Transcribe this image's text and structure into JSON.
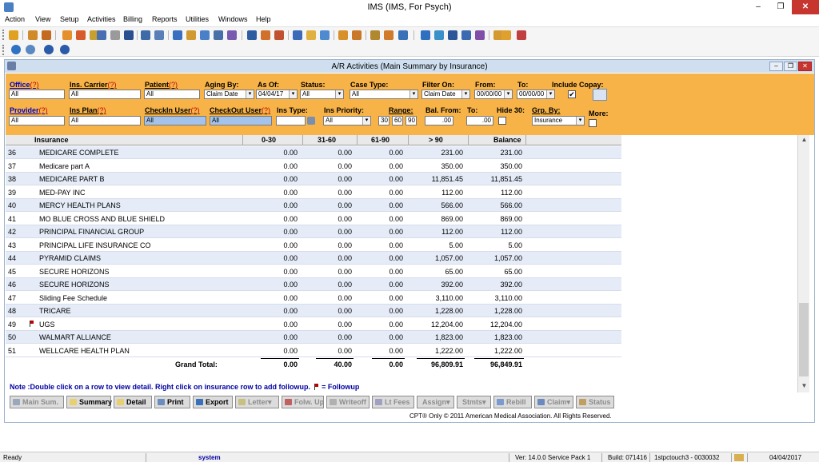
{
  "window": {
    "title": "IMS (IMS, For Psych)",
    "min": "–",
    "max": "❐",
    "close": "✕"
  },
  "menu": [
    "Action",
    "View",
    "Setup",
    "Activities",
    "Billing",
    "Reports",
    "Utilities",
    "Windows",
    "Help"
  ],
  "child": {
    "title": "A/R Activities  (Main Summary by Insurance)"
  },
  "filters": {
    "office": {
      "label": "Office",
      "q": "(?)",
      "value": "All"
    },
    "ins_carrier": {
      "label": "Ins. Carrier",
      "q": "(?)",
      "value": "All"
    },
    "patient": {
      "label": "Patient",
      "q": "(?)",
      "value": "All"
    },
    "aging_by": {
      "label": "Aging By:",
      "value": "Claim Date"
    },
    "as_of": {
      "label": "As Of:",
      "value": "04/04/17"
    },
    "status": {
      "label": "Status:",
      "value": "All"
    },
    "case_type": {
      "label": "Case Type:",
      "value": "All"
    },
    "filter_on": {
      "label": "Filter On:",
      "value": "Claim Date"
    },
    "from": {
      "label": "From:",
      "value": "00/00/00"
    },
    "to": {
      "label": "To:",
      "value": "00/00/00"
    },
    "include_copay": {
      "label": "Include Copay:",
      "check": "✔"
    },
    "provider": {
      "label": "Provider",
      "q": "(?)",
      "value": "All"
    },
    "ins_plan": {
      "label": "Ins Plan",
      "q": "(?)",
      "value": "All"
    },
    "checkin_user": {
      "label": "CheckIn User",
      "q": "(?)",
      "value": "All"
    },
    "checkout_user": {
      "label": "CheckOut User",
      "q": "(?)",
      "value": "All"
    },
    "ins_type": {
      "label": "Ins Type:",
      "value": ""
    },
    "ins_priority": {
      "label": "Ins Priority:",
      "value": "All"
    },
    "range": {
      "label": "Range:",
      "r1": "30",
      "r2": "60",
      "r3": "90"
    },
    "bal_from": {
      "label": "Bal. From:",
      "value": ".00"
    },
    "bal_to": {
      "label": "To:",
      "value": ".00"
    },
    "hide30": {
      "label": "Hide 30:"
    },
    "grp_by": {
      "label": "Grp. By:",
      "value": "Insurance"
    },
    "more": {
      "label": "More:"
    },
    "dropdown_glyph": "▾"
  },
  "grid": {
    "headers": [
      "Insurance",
      "0-30",
      "31-60",
      "61-90",
      "> 90",
      "Balance"
    ],
    "rows": [
      {
        "num": "36",
        "ins": "MEDICARE COMPLETE",
        "c1": "0.00",
        "c2": "0.00",
        "c3": "0.00",
        "c4": "231.00",
        "bal": "231.00",
        "flag": false
      },
      {
        "num": "37",
        "ins": "Medicare part A",
        "c1": "0.00",
        "c2": "0.00",
        "c3": "0.00",
        "c4": "350.00",
        "bal": "350.00",
        "flag": false
      },
      {
        "num": "38",
        "ins": "MEDICARE PART B",
        "c1": "0.00",
        "c2": "0.00",
        "c3": "0.00",
        "c4": "11,851.45",
        "bal": "11,851.45",
        "flag": false
      },
      {
        "num": "39",
        "ins": "MED-PAY INC",
        "c1": "0.00",
        "c2": "0.00",
        "c3": "0.00",
        "c4": "112.00",
        "bal": "112.00",
        "flag": false
      },
      {
        "num": "40",
        "ins": "MERCY HEALTH PLANS",
        "c1": "0.00",
        "c2": "0.00",
        "c3": "0.00",
        "c4": "566.00",
        "bal": "566.00",
        "flag": false
      },
      {
        "num": "41",
        "ins": "MO BLUE CROSS AND BLUE SHIELD",
        "c1": "0.00",
        "c2": "0.00",
        "c3": "0.00",
        "c4": "869.00",
        "bal": "869.00",
        "flag": false
      },
      {
        "num": "42",
        "ins": "PRINCIPAL FINANCIAL GROUP",
        "c1": "0.00",
        "c2": "0.00",
        "c3": "0.00",
        "c4": "112.00",
        "bal": "112.00",
        "flag": false
      },
      {
        "num": "43",
        "ins": "PRINCIPAL LIFE INSURANCE CO",
        "c1": "0.00",
        "c2": "0.00",
        "c3": "0.00",
        "c4": "5.00",
        "bal": "5.00",
        "flag": false
      },
      {
        "num": "44",
        "ins": "PYRAMID CLAIMS",
        "c1": "0.00",
        "c2": "0.00",
        "c3": "0.00",
        "c4": "1,057.00",
        "bal": "1,057.00",
        "flag": false
      },
      {
        "num": "45",
        "ins": "SECURE HORIZONS",
        "c1": "0.00",
        "c2": "0.00",
        "c3": "0.00",
        "c4": "65.00",
        "bal": "65.00",
        "flag": false
      },
      {
        "num": "46",
        "ins": "SECURE HORIZONS",
        "c1": "0.00",
        "c2": "0.00",
        "c3": "0.00",
        "c4": "392.00",
        "bal": "392.00",
        "flag": false
      },
      {
        "num": "47",
        "ins": "Sliding Fee Schedule",
        "c1": "0.00",
        "c2": "0.00",
        "c3": "0.00",
        "c4": "3,110.00",
        "bal": "3,110.00",
        "flag": false
      },
      {
        "num": "48",
        "ins": "TRICARE",
        "c1": "0.00",
        "c2": "0.00",
        "c3": "0.00",
        "c4": "1,228.00",
        "bal": "1,228.00",
        "flag": false
      },
      {
        "num": "49",
        "ins": "UGS",
        "c1": "0.00",
        "c2": "0.00",
        "c3": "0.00",
        "c4": "12,204.00",
        "bal": "12,204.00",
        "flag": true
      },
      {
        "num": "50",
        "ins": "WALMART ALLIANCE",
        "c1": "0.00",
        "c2": "0.00",
        "c3": "0.00",
        "c4": "1,823.00",
        "bal": "1,823.00",
        "flag": false
      },
      {
        "num": "51",
        "ins": "WELLCARE HEALTH PLAN",
        "c1": "0.00",
        "c2": "0.00",
        "c3": "0.00",
        "c4": "1,222.00",
        "bal": "1,222.00",
        "flag": false
      }
    ],
    "total": {
      "label": "Grand Total:",
      "c1": "0.00",
      "c2": "40.00",
      "c3": "0.00",
      "c4": "96,809.91",
      "bal": "96,849.91"
    }
  },
  "note": {
    "text": "Note :Double click on a row to view detail. Right click on insurance row to add followup.",
    "suffix": "= Followup"
  },
  "buttons": {
    "main_sum": "Main Sum.",
    "summary": "Summary",
    "detail": "Detail",
    "print": "Print",
    "export": "Export",
    "letter": "Letter",
    "folw_up": "Folw. Up",
    "writeoff": "Writeoff",
    "lt_fees": "Lt Fees",
    "assign": "Assign",
    "stmts": "Stmts",
    "rebill": "Rebill",
    "claim": "Claim",
    "status": "Status"
  },
  "copyright": "CPT® Only © 2011 American Medical Association. All Rights Reserved.",
  "statusbar": {
    "ready": "Ready",
    "user": "system",
    "version": "Ver: 14.0.0 Service Pack 1",
    "build": "Build: 071416",
    "station": "1stpctouch3 - 0030032",
    "date": "04/04/2017"
  },
  "colors": {
    "filter_bg": "#f7b347",
    "row_alt": "#e5ecf8",
    "link_blue": "#0000c0",
    "required_q": "#c00000"
  }
}
